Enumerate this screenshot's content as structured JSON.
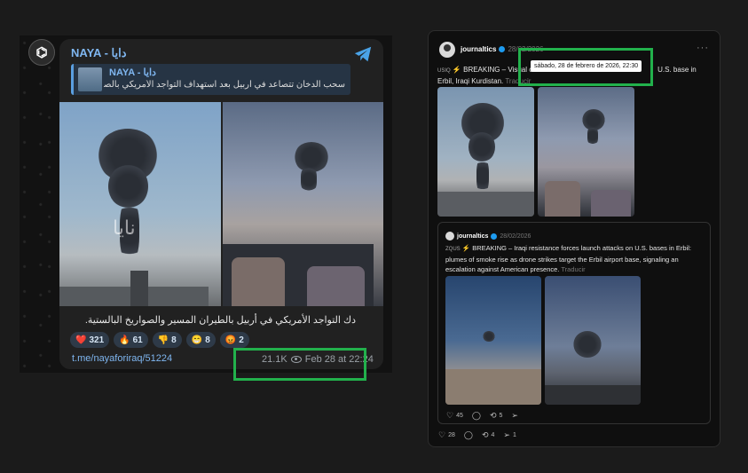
{
  "telegram": {
    "channel_name": "NAYA - دايا",
    "reply": {
      "name": "NAYA - دايا",
      "text": "سحب الدخان تتصاعد في أربيل بعد استهداف التواجد الأمريكي بالصواريخ والمس..."
    },
    "caption": "دك التواجد الأمريكي في أربيل بالطيران المسير والصواريخ البالستية.",
    "reactions": [
      {
        "emoji": "❤️",
        "count": "321"
      },
      {
        "emoji": "🔥",
        "count": "61"
      },
      {
        "emoji": "👎",
        "count": "8"
      },
      {
        "emoji": "😁",
        "count": "8"
      },
      {
        "emoji": "😡",
        "count": "2"
      }
    ],
    "link": "t.me/nayaforiraq/51224",
    "views": "21.1K",
    "timestamp": "Feb 28 at 22:24",
    "watermark": "نايا"
  },
  "x_post": {
    "username": "journaltics",
    "date": "28/02/2026",
    "tooltip": "sábado, 28 de febrero de 2026, 22:30",
    "text_before": "BREAKING – Visual co",
    "text_after": "U.S. base in Erbil, Iraqi Kurdistan.",
    "translate_label": "Traducir",
    "actions": {
      "likes": "28",
      "comments": "",
      "reposts": "4",
      "shares": "1"
    },
    "quote": {
      "username": "journaltics",
      "date": "28/02/2026",
      "text": "BREAKING – Iraqi resistance forces launch attacks on U.S. bases in Erbil: plumes of smoke rise as drone strikes target the Erbil airport base, signaling an escalation against American presence.",
      "translate_label": "Traducir",
      "actions": {
        "likes": "45",
        "comments": "",
        "reposts": "5",
        "shares": ""
      }
    }
  }
}
